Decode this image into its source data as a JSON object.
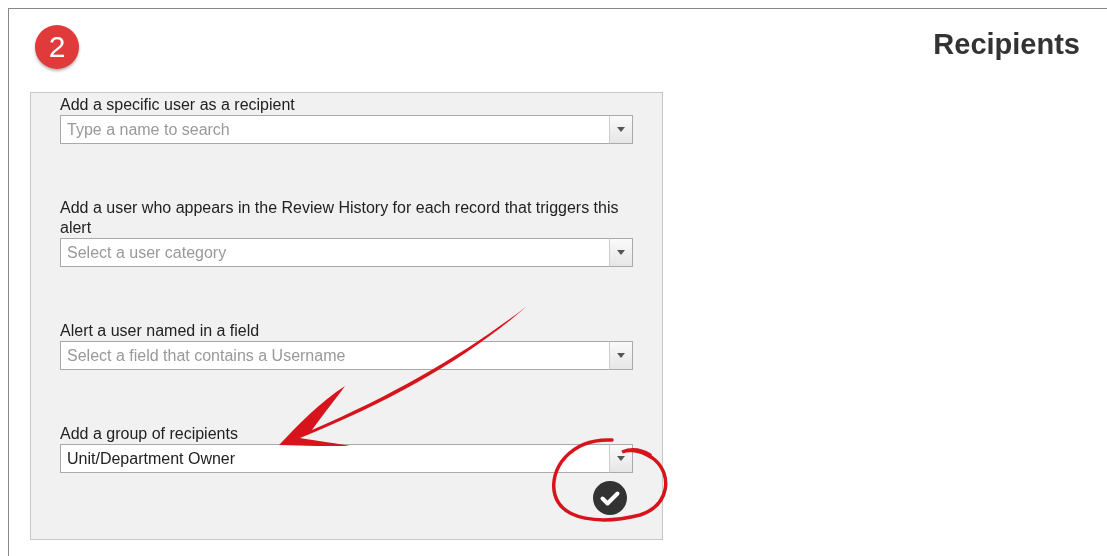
{
  "step_badge": "2",
  "title": "Recipients",
  "fields": [
    {
      "label": "Add a specific user as a recipient",
      "placeholder": "Type a name to search"
    },
    {
      "label": "Add a user who appears in the Review History for each record that triggers this alert",
      "placeholder": "Select a user category"
    },
    {
      "label": "Alert a user named in a field",
      "placeholder": "Select a field that contains a Username"
    },
    {
      "label": "Add a group of recipients",
      "value": "Unit/Department Owner"
    }
  ]
}
